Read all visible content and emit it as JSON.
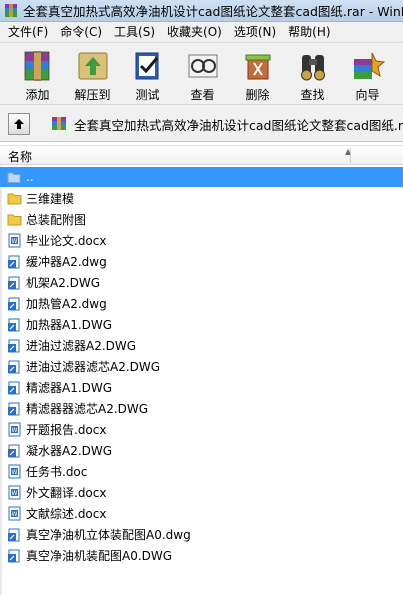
{
  "window": {
    "title": "全套真空加热式高效净油机设计cad图纸论文整套cad图纸.rar - WinRAR"
  },
  "menu": [
    {
      "label": "文件(F)"
    },
    {
      "label": "命令(C)"
    },
    {
      "label": "工具(S)"
    },
    {
      "label": "收藏夹(O)"
    },
    {
      "label": "选项(N)"
    },
    {
      "label": "帮助(H)"
    }
  ],
  "toolbar": [
    {
      "label": "添加",
      "icon": "add-archive-icon"
    },
    {
      "label": "解压到",
      "icon": "extract-to-icon"
    },
    {
      "label": "测试",
      "icon": "test-icon"
    },
    {
      "label": "查看",
      "icon": "view-icon"
    },
    {
      "label": "删除",
      "icon": "delete-icon"
    },
    {
      "label": "查找",
      "icon": "find-icon"
    },
    {
      "label": "向导",
      "icon": "wizard-icon"
    }
  ],
  "address": {
    "path": "全套真空加热式高效净油机设计cad图纸论文整套cad图纸.rar"
  },
  "list": {
    "column_name": "名称",
    "items": [
      {
        "name": "..",
        "type": "parent",
        "selected": true
      },
      {
        "name": "三维建模",
        "type": "folder"
      },
      {
        "name": "总装配附图",
        "type": "folder"
      },
      {
        "name": "毕业论文.docx",
        "type": "docx"
      },
      {
        "name": "缓冲器A2.dwg",
        "type": "dwg"
      },
      {
        "name": "机架A2.DWG",
        "type": "dwg"
      },
      {
        "name": "加热管A2.dwg",
        "type": "dwg"
      },
      {
        "name": "加热器A1.DWG",
        "type": "dwg"
      },
      {
        "name": "进油过滤器A2.DWG",
        "type": "dwg"
      },
      {
        "name": "进油过滤器滤芯A2.DWG",
        "type": "dwg"
      },
      {
        "name": "精滤器A1.DWG",
        "type": "dwg"
      },
      {
        "name": "精滤器器滤芯A2.DWG",
        "type": "dwg"
      },
      {
        "name": "开题报告.docx",
        "type": "docx"
      },
      {
        "name": "凝水器A2.DWG",
        "type": "dwg"
      },
      {
        "name": "任务书.doc",
        "type": "doc"
      },
      {
        "name": "外文翻译.docx",
        "type": "docx"
      },
      {
        "name": "文献综述.docx",
        "type": "docx"
      },
      {
        "name": "真空净油机立体装配图A0.dwg",
        "type": "dwg"
      },
      {
        "name": "真空净油机装配图A0.DWG",
        "type": "dwg"
      }
    ]
  },
  "colors": {
    "selection": "#3399ff",
    "folder": "#f2c84b",
    "dwg": "#2f6fc2"
  }
}
